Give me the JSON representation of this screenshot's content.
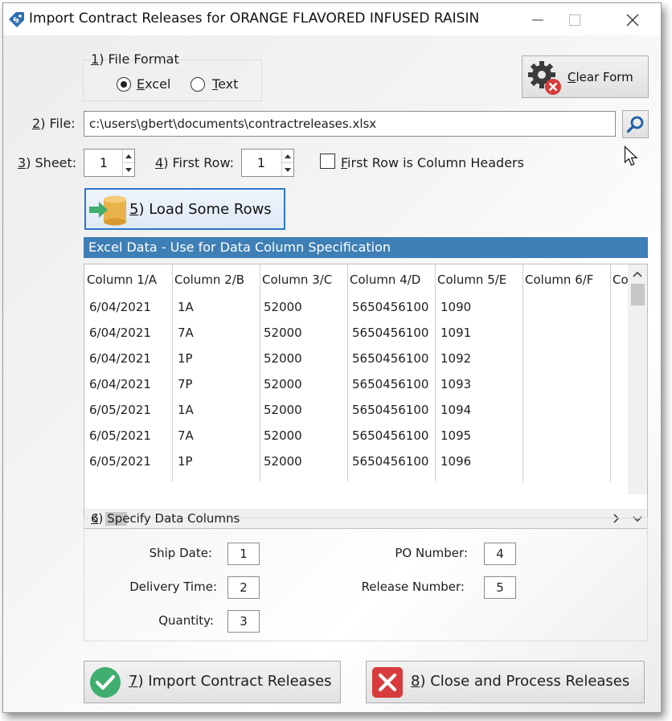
{
  "window": {
    "title": "Import Contract Releases for ORANGE FLAVORED INFUSED RAISIN"
  },
  "file_format": {
    "title_num": "1",
    "title_text": ") File Format",
    "options": [
      {
        "key": "E",
        "rest": "xcel",
        "selected": true
      },
      {
        "key": "T",
        "rest": "ext",
        "selected": false
      }
    ]
  },
  "clear_form": {
    "key": "C",
    "rest": "lear Form"
  },
  "file": {
    "label_num": "2",
    "label_rest": ") File:",
    "value": "c:\\users\\gbert\\documents\\contractreleases.xlsx"
  },
  "sheet": {
    "label_num": "3",
    "label_rest": ") Sheet:",
    "value": "1"
  },
  "first_row": {
    "label_num": "4",
    "label_rest": ") First Row:",
    "value": "1"
  },
  "headers_checkbox": {
    "key": "F",
    "rest": "irst Row is Column Headers",
    "checked": false
  },
  "load_button": {
    "key": "5",
    "rest": ")  Load Some Rows"
  },
  "grid": {
    "title": "Excel Data - Use for Data Column Specification",
    "columns": [
      "Column 1/A",
      "Column 2/B",
      "Column 3/C",
      "Column 4/D",
      "Column 5/E",
      "Column 6/F",
      "Co"
    ],
    "rows": [
      [
        "6/04/2021",
        "1A",
        "52000",
        "5650456100",
        "1090"
      ],
      [
        "6/04/2021",
        "7A",
        "52000",
        "5650456100",
        "1091"
      ],
      [
        "6/04/2021",
        "1P",
        "52000",
        "5650456100",
        "1092"
      ],
      [
        "6/04/2021",
        "7P",
        "52000",
        "5650456100",
        "1093"
      ],
      [
        "6/05/2021",
        "1A",
        "52000",
        "5650456100",
        "1094"
      ],
      [
        "6/05/2021",
        "7A",
        "52000",
        "5650456100",
        "1095"
      ],
      [
        "6/05/2021",
        "1P",
        "52000",
        "5650456100",
        "1096"
      ]
    ]
  },
  "spec": {
    "title_num": "6",
    "title_rest": ") Specify Data Columns",
    "fields": [
      {
        "label": "Ship Date:",
        "value": "1"
      },
      {
        "label": "Delivery Time:",
        "value": "2"
      },
      {
        "label": "Quantity:",
        "value": "3"
      },
      {
        "label": "PO Number:",
        "value": "4"
      },
      {
        "label": "Release Number:",
        "value": "5"
      }
    ]
  },
  "import_button": {
    "key": "7",
    "rest": ") Import Contract Releases"
  },
  "close_button": {
    "key": "8",
    "rest": ") Close and Process Releases"
  },
  "colors": {
    "grid_header": "#3e7fb5",
    "search_icon": "#1f5fa8",
    "check_green": "#3fae6e",
    "close_red": "#d83b3b"
  }
}
